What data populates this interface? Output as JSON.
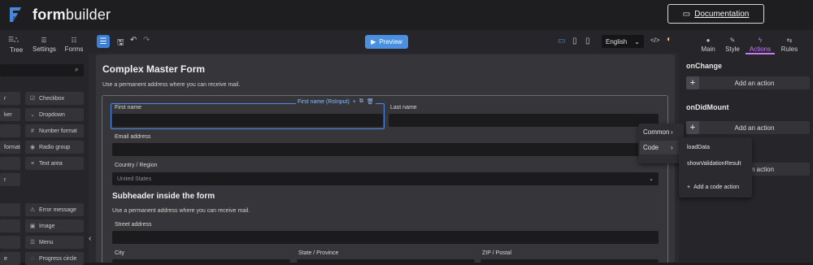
{
  "header": {
    "logo_bold": "form",
    "logo_light": "builder",
    "doc_label": "Documentation",
    "brand_color": "#3d7fd6"
  },
  "left_panel": {
    "tabs": [
      {
        "label": "",
        "icon": "list-icon"
      },
      {
        "label": "Tree",
        "icon": "tree-icon"
      },
      {
        "label": "Settings",
        "icon": "settings-icon"
      },
      {
        "label": "Forms",
        "icon": "forms-icon"
      }
    ],
    "components_left": [
      "r",
      "ker",
      "",
      "format",
      "",
      "r",
      "",
      "",
      "",
      "e"
    ],
    "components_right": [
      {
        "label": "Checkbox",
        "icon": "checkbox-icon"
      },
      {
        "label": "Dropdown",
        "icon": "chevron-down-icon"
      },
      {
        "label": "Number format",
        "icon": "number-format-icon"
      },
      {
        "label": "Radio group",
        "icon": "radio-icon"
      },
      {
        "label": "Text area",
        "icon": "text-area-icon"
      },
      {
        "label": "Error message",
        "icon": "warning-icon"
      },
      {
        "label": "Image",
        "icon": "image-icon"
      },
      {
        "label": "Menu",
        "icon": "menu-icon"
      },
      {
        "label": "Progress circle",
        "icon": "progress-circle-icon"
      }
    ]
  },
  "toolbar": {
    "preview_label": "Preview",
    "language": "English"
  },
  "form": {
    "title": "Complex Master Form",
    "description": "Use a permanent address where you can receive mail.",
    "selected_tag": "First name (RsInput)",
    "fields": {
      "first_name": "First name",
      "last_name": "Last name",
      "email": "Email address",
      "country": "Country / Region",
      "country_value": "United States",
      "street": "Street address",
      "city": "City",
      "state": "State / Province",
      "zip": "ZIP / Postal"
    },
    "subheader": "Subheader inside the form",
    "sub_description": "Use a permanent address where you can receive mail."
  },
  "right_panel": {
    "tabs": [
      {
        "label": "Main",
        "icon": "circle-icon"
      },
      {
        "label": "Style",
        "icon": "brush-icon"
      },
      {
        "label": "Actions",
        "icon": "bolt-icon"
      },
      {
        "label": "Rules",
        "icon": "rules-icon"
      }
    ],
    "active_tab": "Actions",
    "accent_color": "#c77cf2",
    "events": [
      {
        "name": "onChange",
        "add_label": "Add an action"
      },
      {
        "name": "onDidMount",
        "add_label": "Add an action"
      }
    ],
    "third_add_label_visible": "n action"
  },
  "context_menu": {
    "items": [
      "Common",
      "Code"
    ],
    "submenu": [
      "loadData",
      "showValidationResult"
    ],
    "add_code_action": "Add a code action"
  }
}
